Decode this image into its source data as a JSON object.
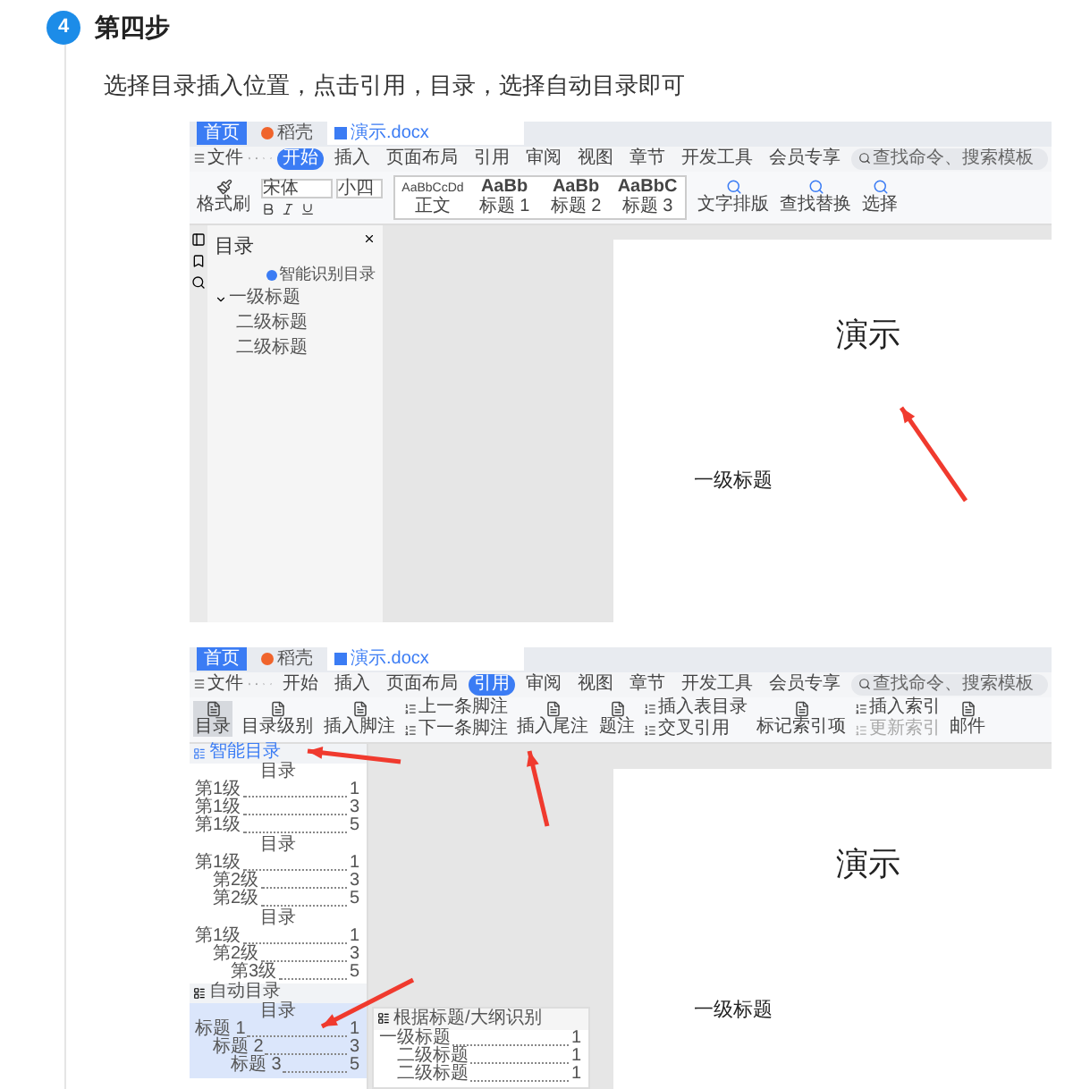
{
  "step": {
    "number": "4",
    "title": "第四步",
    "instruction": "选择目录插入位置，点击引用，目录，选择自动目录即可"
  },
  "screenshot_1": {
    "doc_tabs": [
      {
        "label": "首页",
        "kind": "home",
        "selected": false
      },
      {
        "label": "稻壳",
        "kind": "app",
        "selected": false
      },
      {
        "label": "演示.docx",
        "kind": "document",
        "selected": true
      }
    ],
    "file_menu": "文件",
    "menu_tabs": [
      {
        "label": "开始",
        "selected": true
      },
      {
        "label": "插入",
        "selected": false
      },
      {
        "label": "页面布局",
        "selected": false
      },
      {
        "label": "引用",
        "selected": false
      },
      {
        "label": "审阅",
        "selected": false
      },
      {
        "label": "视图",
        "selected": false
      },
      {
        "label": "章节",
        "selected": false
      },
      {
        "label": "开发工具",
        "selected": false
      },
      {
        "label": "会员专享",
        "selected": false
      }
    ],
    "search": {
      "placeholder": "查找命令、搜索模板"
    },
    "format_painter": "格式刷",
    "font": "宋体",
    "font_size": "小四",
    "styles": [
      {
        "preview": "AaBbCcDd",
        "label": "正文"
      },
      {
        "preview": "AaBb",
        "label": "标题 1"
      },
      {
        "preview": "AaBb",
        "label": "标题 2"
      },
      {
        "preview": "AaBbC",
        "label": "标题 3"
      }
    ],
    "tools": [
      "文字排版",
      "查找替换",
      "选择"
    ],
    "nav_panel": {
      "title": "目录",
      "smart_button": "智能识别目录",
      "tree": [
        {
          "label": "一级标题",
          "expanded": true,
          "children": [
            {
              "label": "二级标题"
            },
            {
              "label": "二级标题"
            }
          ]
        }
      ]
    },
    "document": {
      "title": "演示",
      "heading": "一级标题"
    }
  },
  "screenshot_2": {
    "doc_tabs": [
      {
        "label": "首页",
        "kind": "home",
        "selected": false
      },
      {
        "label": "稻壳",
        "kind": "app",
        "selected": false
      },
      {
        "label": "演示.docx",
        "kind": "document",
        "selected": true
      }
    ],
    "file_menu": "文件",
    "menu_tabs": [
      {
        "label": "开始",
        "selected": false
      },
      {
        "label": "插入",
        "selected": false
      },
      {
        "label": "页面布局",
        "selected": false
      },
      {
        "label": "引用",
        "selected": true
      },
      {
        "label": "审阅",
        "selected": false
      },
      {
        "label": "视图",
        "selected": false
      },
      {
        "label": "章节",
        "selected": false
      },
      {
        "label": "开发工具",
        "selected": false
      },
      {
        "label": "会员专享",
        "selected": false
      }
    ],
    "search": {
      "placeholder": "查找命令、搜索模板"
    },
    "ribbon": [
      {
        "kind": "large",
        "label": "目录",
        "selected": true
      },
      {
        "kind": "large",
        "label": "目录级别",
        "selected": false
      },
      {
        "kind": "large",
        "label": "插入脚注",
        "selected": false
      },
      {
        "kind": "pair",
        "items": [
          {
            "label": "上一条脚注",
            "disabled": false
          },
          {
            "label": "下一条脚注",
            "disabled": false
          }
        ]
      },
      {
        "kind": "large",
        "label": "插入尾注",
        "selected": false
      },
      {
        "kind": "large",
        "label": "题注",
        "selected": false
      },
      {
        "kind": "pair",
        "items": [
          {
            "label": "插入表目录",
            "disabled": false
          },
          {
            "label": "交叉引用",
            "disabled": false
          }
        ]
      },
      {
        "kind": "large",
        "label": "标记索引项",
        "selected": false
      },
      {
        "kind": "pair",
        "items": [
          {
            "label": "插入索引",
            "disabled": false
          },
          {
            "label": "更新索引",
            "disabled": true
          }
        ]
      },
      {
        "kind": "large",
        "label": "邮件",
        "selected": false
      }
    ],
    "smart_toc": "智能目录",
    "presets": [
      {
        "heading": "目录",
        "entries": [
          {
            "label": "第1级",
            "page": "1"
          },
          {
            "label": "第1级",
            "page": "3"
          },
          {
            "label": "第1级",
            "page": "5"
          }
        ]
      },
      {
        "heading": "目录",
        "entries": [
          {
            "label": "第1级",
            "page": "1",
            "children": [
              {
                "label": "第2级",
                "page": "3"
              },
              {
                "label": "第2级",
                "page": "5"
              }
            ]
          }
        ]
      },
      {
        "heading": "目录",
        "entries": [
          {
            "label": "第1级",
            "page": "1",
            "children": [
              {
                "label": "第2级",
                "page": "3",
                "children": [
                  {
                    "label": "第3级",
                    "page": "5"
                  }
                ]
              }
            ]
          }
        ]
      }
    ],
    "auto_toc": {
      "title": "自动目录",
      "heading": "目录",
      "selected": true,
      "entries": [
        {
          "label": "标题 1",
          "page": "1",
          "children": [
            {
              "label": "标题 2",
              "page": "3",
              "children": [
                {
                  "label": "标题 3",
                  "page": "5"
                }
              ]
            }
          ]
        }
      ]
    },
    "outline_toc": {
      "title": "根据标题/大纲识别",
      "entries": [
        {
          "label": "一级标题",
          "page": "1",
          "children": [
            {
              "label": "二级标题",
              "page": "1"
            },
            {
              "label": "二级标题",
              "page": "1"
            }
          ]
        }
      ]
    },
    "document": {
      "title": "演示",
      "heading": "一级标题"
    }
  }
}
